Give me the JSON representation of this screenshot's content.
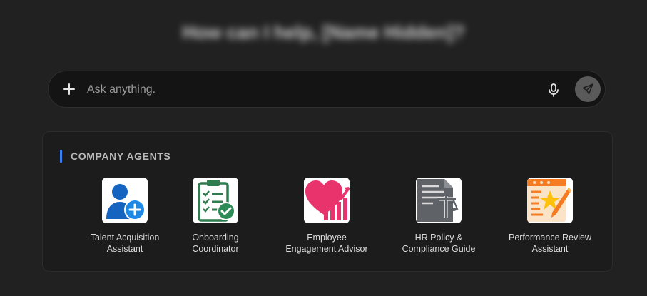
{
  "greeting": "How can I help, [Name Hidden]?",
  "chat": {
    "placeholder": "Ask anything."
  },
  "icons": {
    "plus": "plus-icon",
    "mic": "microphone-icon",
    "send": "send-icon"
  },
  "agents_section": {
    "title": "COMPANY AGENTS",
    "accent_color": "#3b82f6",
    "agents": [
      {
        "line1": "Talent Acquisition",
        "line2": "Assistant",
        "icon": "user-add-icon"
      },
      {
        "line1": "Onboarding",
        "line2": "Coordinator",
        "icon": "clipboard-check-icon"
      },
      {
        "line1": "Employee",
        "line2": "Engagement Advisor",
        "icon": "heart-growth-icon"
      },
      {
        "line1": "HR Policy &",
        "line2": "Compliance Guide",
        "icon": "scales-document-icon"
      },
      {
        "line1": "Performance Review",
        "line2": "Assistant",
        "icon": "star-review-icon"
      }
    ]
  }
}
